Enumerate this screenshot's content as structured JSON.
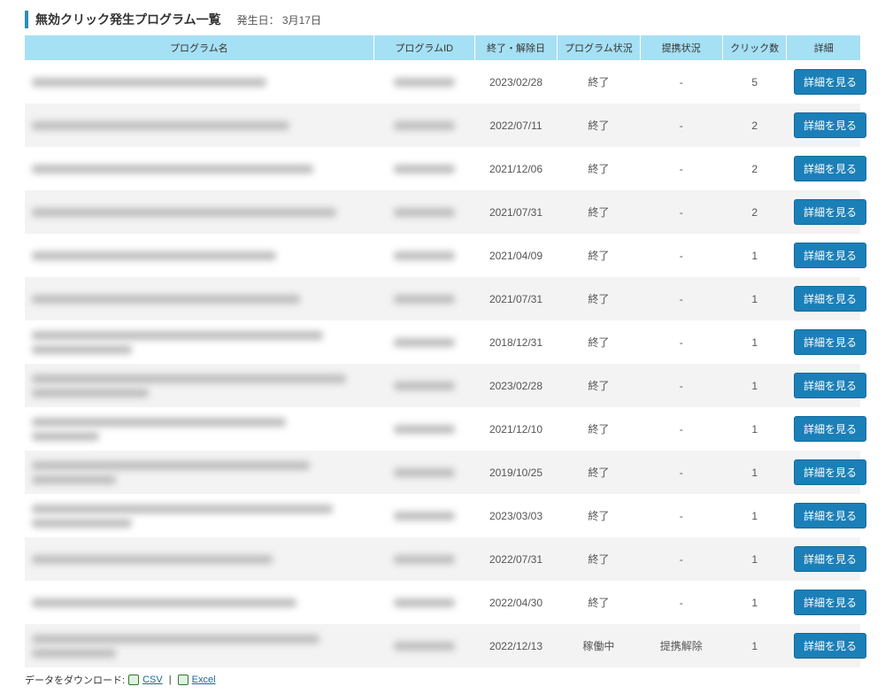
{
  "header": {
    "title": "無効クリック発生プログラム一覧",
    "date_label": "発生日： 3月17日"
  },
  "columns": {
    "program_name": "プログラム名",
    "program_id": "プログラムID",
    "end_date": "終了・解除日",
    "program_status": "プログラム状況",
    "partner_status": "提携状況",
    "clicks": "クリック数",
    "detail": "詳細"
  },
  "detail_button_label": "詳細を見る",
  "rows": [
    {
      "end_date": "2023/02/28",
      "program_status": "終了",
      "partner_status": "-",
      "clicks": "5",
      "two_line": false
    },
    {
      "end_date": "2022/07/11",
      "program_status": "終了",
      "partner_status": "-",
      "clicks": "2",
      "two_line": false
    },
    {
      "end_date": "2021/12/06",
      "program_status": "終了",
      "partner_status": "-",
      "clicks": "2",
      "two_line": false
    },
    {
      "end_date": "2021/07/31",
      "program_status": "終了",
      "partner_status": "-",
      "clicks": "2",
      "two_line": false
    },
    {
      "end_date": "2021/04/09",
      "program_status": "終了",
      "partner_status": "-",
      "clicks": "1",
      "two_line": false
    },
    {
      "end_date": "2021/07/31",
      "program_status": "終了",
      "partner_status": "-",
      "clicks": "1",
      "two_line": false
    },
    {
      "end_date": "2018/12/31",
      "program_status": "終了",
      "partner_status": "-",
      "clicks": "1",
      "two_line": true
    },
    {
      "end_date": "2023/02/28",
      "program_status": "終了",
      "partner_status": "-",
      "clicks": "1",
      "two_line": true
    },
    {
      "end_date": "2021/12/10",
      "program_status": "終了",
      "partner_status": "-",
      "clicks": "1",
      "two_line": true
    },
    {
      "end_date": "2019/10/25",
      "program_status": "終了",
      "partner_status": "-",
      "clicks": "1",
      "two_line": true
    },
    {
      "end_date": "2023/03/03",
      "program_status": "終了",
      "partner_status": "-",
      "clicks": "1",
      "two_line": true
    },
    {
      "end_date": "2022/07/31",
      "program_status": "終了",
      "partner_status": "-",
      "clicks": "1",
      "two_line": false
    },
    {
      "end_date": "2022/04/30",
      "program_status": "終了",
      "partner_status": "-",
      "clicks": "1",
      "two_line": false
    },
    {
      "end_date": "2022/12/13",
      "program_status": "稼働中",
      "partner_status": "提携解除",
      "clicks": "1",
      "two_line": true
    }
  ],
  "download": {
    "label": "データをダウンロード:",
    "csv": "CSV",
    "excel": "Excel"
  }
}
